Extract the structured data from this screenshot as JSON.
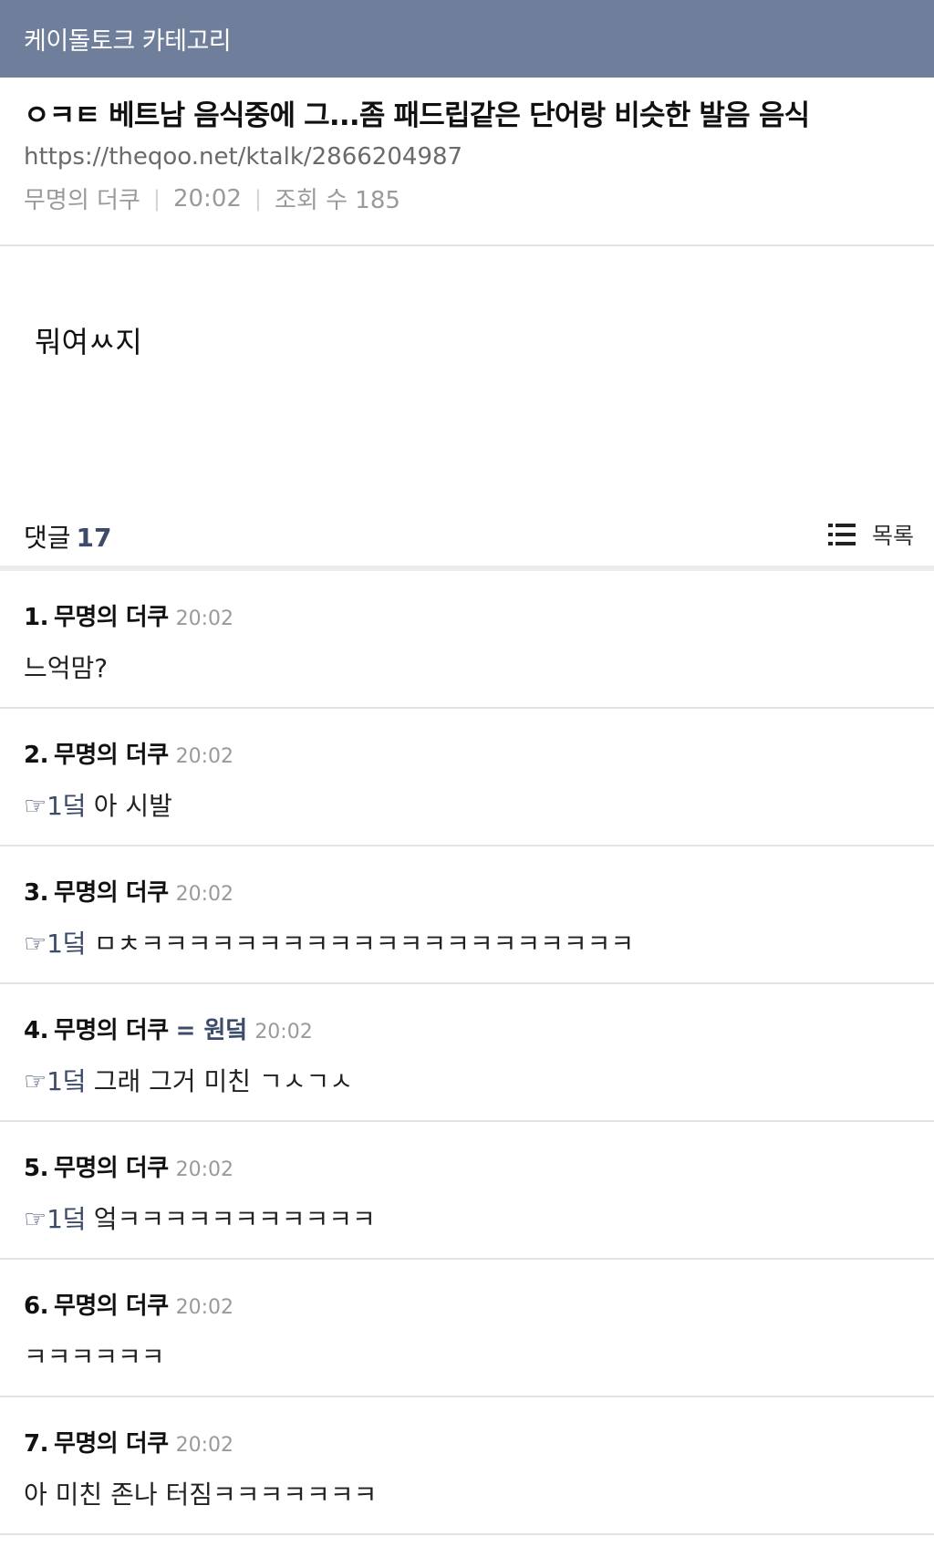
{
  "header": {
    "category": "케이돌토크 카테고리"
  },
  "post": {
    "title": "ㅇㅋㅌ 베트남 음식중에 그...좀 패드립같은 단어랑 비슷한 발음 음식",
    "url": "https://theqoo.net/ktalk/2866204987",
    "author": "무명의 더쿠",
    "time": "20:02",
    "views": "조회 수 185",
    "body": "뭐여ㅆ지"
  },
  "comments_bar": {
    "label": "댓글",
    "count": "17",
    "list_label": "목록"
  },
  "comments": [
    {
      "number": "1.",
      "author": "무명의 더쿠",
      "tag": "",
      "time": "20:02",
      "reply": "",
      "text": "느억맘?"
    },
    {
      "number": "2.",
      "author": "무명의 더쿠",
      "tag": "",
      "time": "20:02",
      "reply": "☞1덬",
      "text": "아 시발"
    },
    {
      "number": "3.",
      "author": "무명의 더쿠",
      "tag": "",
      "time": "20:02",
      "reply": "☞1덬",
      "text": "ㅁㅊㅋㅋㅋㅋㅋㅋㅋㅋㅋㅋㅋㅋㅋㅋㅋㅋㅋㅋㅋㅋㅋ"
    },
    {
      "number": "4.",
      "author": "무명의 더쿠",
      "tag": "= 원덬",
      "time": "20:02",
      "reply": "☞1덬",
      "text": "그래 그거 미친 ㄱㅅㄱㅅ"
    },
    {
      "number": "5.",
      "author": "무명의 더쿠",
      "tag": "",
      "time": "20:02",
      "reply": "☞1덬",
      "text": "엌ㅋㅋㅋㅋㅋㅋㅋㅋㅋㅋㅋ"
    },
    {
      "number": "6.",
      "author": "무명의 더쿠",
      "tag": "",
      "time": "20:02",
      "reply": "",
      "text": "ㅋㅋㅋㅋㅋㅋ"
    },
    {
      "number": "7.",
      "author": "무명의 더쿠",
      "tag": "",
      "time": "20:02",
      "reply": "",
      "text": "아 미친 존나 터짐ㅋㅋㅋㅋㅋㅋㅋ"
    }
  ],
  "icons": {
    "list": "list-icon"
  },
  "colors": {
    "topbar": "#6f7e9a",
    "accent": "#3c4b6a"
  }
}
